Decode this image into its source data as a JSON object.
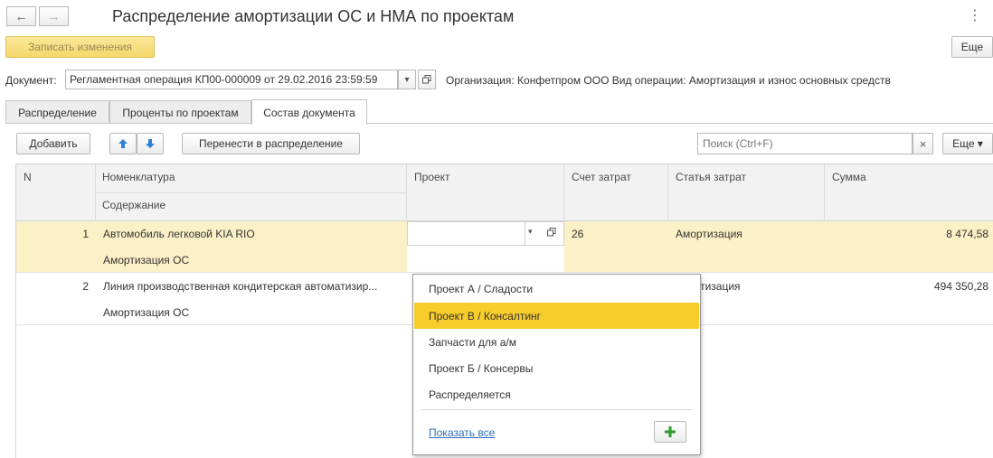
{
  "header": {
    "title": "Распределение амортизации ОС и НМА по проектам",
    "back_icon": "←",
    "forward_icon": "→",
    "more_icon": "⋮"
  },
  "toolbar": {
    "save_label": "Записать изменения",
    "more_label": "Еще"
  },
  "document": {
    "label": "Документ:",
    "value": "Регламентная операция КП00-000009 от 29.02.2016 23:59:59",
    "info": "Организация: Конфетпром ООО Вид операции: Амортизация и износ основных средств"
  },
  "tabs": [
    {
      "label": "Распределение"
    },
    {
      "label": "Проценты по проектам"
    },
    {
      "label": "Состав документа"
    }
  ],
  "table_toolbar": {
    "add_label": "Добавить",
    "move_label": "Перенести в распределение",
    "search_placeholder": "Поиск (Ctrl+F)",
    "clear_icon": "×",
    "more_label": "Еще ▾"
  },
  "table": {
    "headers": {
      "n": "N",
      "nomenclature": "Номенклатура",
      "content": "Содержание",
      "project": "Проект",
      "account": "Счет затрат",
      "cost_item": "Статья затрат",
      "sum": "Сумма"
    },
    "rows": [
      {
        "n": "1",
        "nomenclature": "Автомобиль легковой KIA RIO",
        "content": "Амортизация ОС",
        "project": "",
        "account": "26",
        "cost_item": "Амортизация",
        "sum": "8 474,58"
      },
      {
        "n": "2",
        "nomenclature": "Линия производственная кондитерская автоматизир...",
        "content": "Амортизация ОС",
        "project": "",
        "account": "",
        "cost_item": "ортизация",
        "sum": "494 350,28"
      }
    ]
  },
  "dropdown": {
    "items": [
      {
        "label": "Проект А / Сладости"
      },
      {
        "label": "Проект В / Консалтинг"
      },
      {
        "label": "Запчасти для а/м"
      },
      {
        "label": "Проект Б / Консервы"
      },
      {
        "label": "Распределяется"
      }
    ],
    "show_all": "Показать все"
  },
  "colors": {
    "accent_yellow": "#f7cc2b",
    "selected_row": "#fcf0c6",
    "link": "#2a6db6",
    "plus_green": "#2e9a2e",
    "arrow_blue": "#2f7fd3"
  }
}
